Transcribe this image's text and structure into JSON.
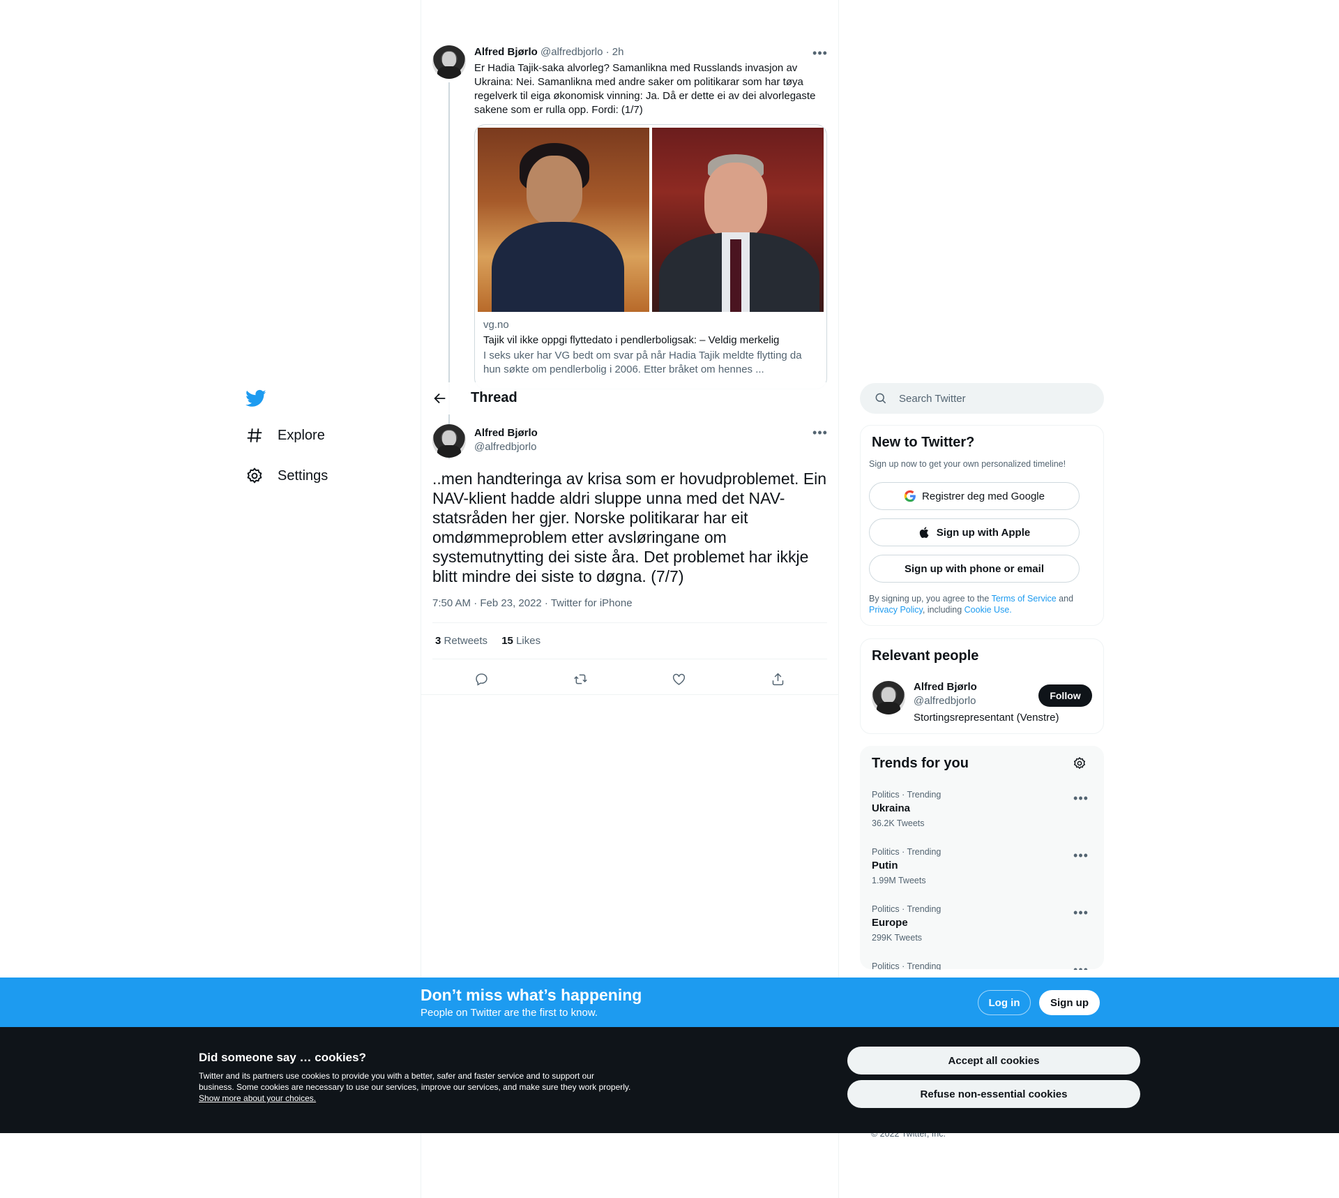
{
  "brand": {
    "accent": "#1d9bf0",
    "logo_icon": "twitter-bird-icon"
  },
  "nav": {
    "items": [
      {
        "label": "Explore",
        "icon": "hashtag-icon"
      },
      {
        "label": "Settings",
        "icon": "gear-icon"
      }
    ]
  },
  "prev_tweet": {
    "name": "Alfred Bjørlo",
    "handle": "@alfredbjorlo",
    "time": "· 2h",
    "text": "Er Hadia Tajik-saka alvorleg? Samanlikna med Russlands invasjon av Ukraina: Nei. Samanlikna med andre saker om politikarar som har tøya regelverk til eiga økonomisk vinning: Ja. Då er dette ei av dei alvorlegaste sakene som er rulla opp. Fordi: (1/7)",
    "card": {
      "domain": "vg.no",
      "title": "Tajik vil ikke oppgi flyttedato i pendlerboligsak: – Veldig merkelig",
      "description": "I seks uker har VG bedt om svar på når Hadia Tajik meldte flytting da hun søkte om pendlerbolig i 2006. Etter bråket om hennes ..."
    }
  },
  "header": {
    "title": "Thread"
  },
  "tweet": {
    "name": "Alfred Bjørlo",
    "handle": "@alfredbjorlo",
    "text": "..men handteringa av krisa som er hovudproblemet. Ein NAV-klient hadde aldri sluppe unna med det NAV-statsråden her gjer. Norske politikarar har eit omdømmeproblem etter avsløringane om systemutnytting dei siste åra. Det problemet har ikkje blitt mindre dei siste to døgna. (7/7)",
    "meta": "7:50 AM · Feb 23, 2022 · Twitter for iPhone",
    "retweets_count": "3",
    "retweets_label": "Retweets",
    "likes_count": "15",
    "likes_label": "Likes"
  },
  "search": {
    "placeholder": "Search Twitter"
  },
  "new_to_twitter": {
    "title": "New to Twitter?",
    "subtitle": "Sign up now to get your own personalized timeline!",
    "google_label": "Registrer deg med Google",
    "apple_label": "Sign up with Apple",
    "phone_label": "Sign up with phone or email",
    "legal_prefix": "By signing up, you agree to the",
    "terms": "Terms of Service",
    "and": "and",
    "privacy": "Privacy Policy",
    "including": ", including",
    "cookie_use": "Cookie Use."
  },
  "relevant_people": {
    "title": "Relevant people",
    "name": "Alfred Bjørlo",
    "handle": "@alfredbjorlo",
    "bio": "Stortingsrepresentant (Venstre)",
    "follow_label": "Follow"
  },
  "trends": {
    "title": "Trends for you",
    "items": [
      {
        "category": "Politics · Trending",
        "name": "Ukraina",
        "count": "36.2K Tweets"
      },
      {
        "category": "Politics · Trending",
        "name": "Putin",
        "count": "1.99M Tweets"
      },
      {
        "category": "Politics · Trending",
        "name": "Europe",
        "count": "299K Tweets"
      },
      {
        "category": "Politics · Trending",
        "name": "",
        "count": ""
      }
    ]
  },
  "footer": {
    "copyright": "© 2022 Twitter, Inc."
  },
  "banner": {
    "title": "Don’t miss what’s happening",
    "subtitle": "People on Twitter are the first to know.",
    "login_label": "Log in",
    "signup_label": "Sign up"
  },
  "cookie": {
    "title": "Did someone say … cookies?",
    "text": "Twitter and its partners use cookies to provide you with a better, safer and faster service and to support our business. Some cookies are necessary to use our services, improve our services, and make sure they work properly.",
    "link": "Show more about your choices.",
    "accept_label": "Accept all cookies",
    "refuse_label": "Refuse non-essential cookies"
  }
}
